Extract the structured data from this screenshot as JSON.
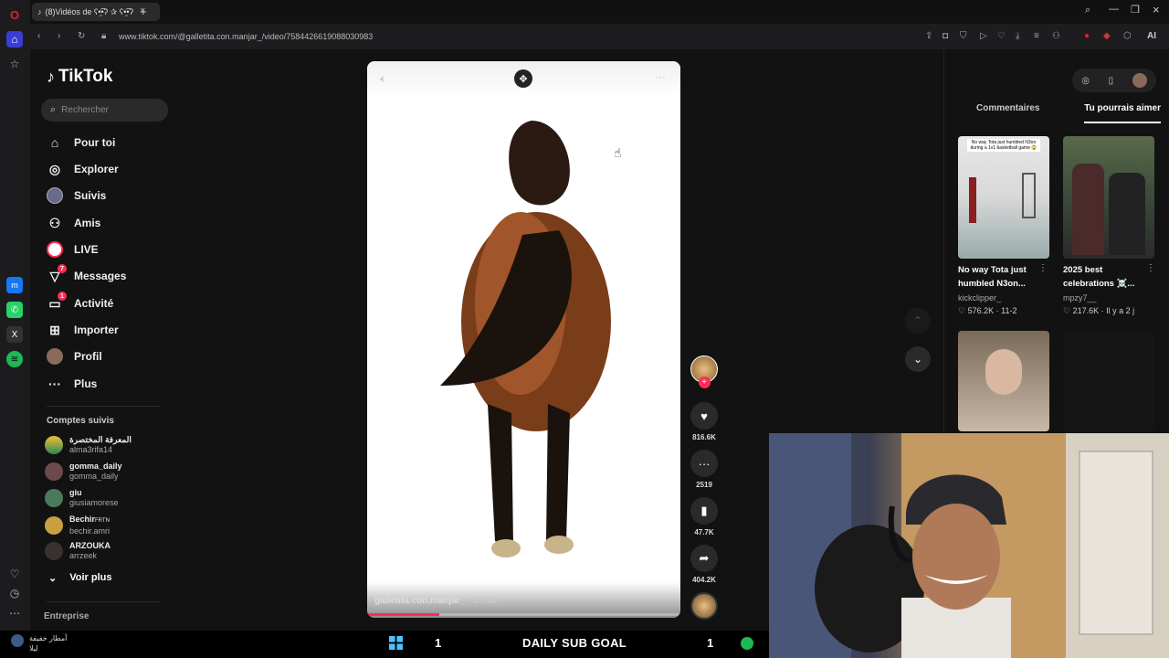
{
  "browser": {
    "tab_title": "(8)Vidéos de ʕ•̫͡•ʔ ✰ ʕ•̫͡•ʔ",
    "url": "www.tiktok.com/@galletita.con.manjar_/video/7584426619088030983",
    "ai_label": "AI"
  },
  "tiktok": {
    "logo": "TikTok",
    "search_placeholder": "Rechercher",
    "nav": [
      {
        "label": "Pour toi",
        "icon": "home-icon"
      },
      {
        "label": "Explorer",
        "icon": "compass-icon"
      },
      {
        "label": "Suivis",
        "icon": "following-avatar-icon"
      },
      {
        "label": "Amis",
        "icon": "friends-icon"
      },
      {
        "label": "LIVE",
        "icon": "live-icon"
      },
      {
        "label": "Messages",
        "icon": "messages-icon",
        "badge": "7"
      },
      {
        "label": "Activité",
        "icon": "activity-icon",
        "badge": "1"
      },
      {
        "label": "Importer",
        "icon": "upload-icon"
      },
      {
        "label": "Profil",
        "icon": "profile-icon"
      },
      {
        "label": "Plus",
        "icon": "more-icon"
      }
    ],
    "followed_title": "Comptes suivis",
    "followed": [
      {
        "name": "المعرفة المختصرة",
        "handle": "alma3rifa14"
      },
      {
        "name": "gomma_daily",
        "handle": "gomma_daily"
      },
      {
        "name": "giu",
        "handle": "giusiamorese"
      },
      {
        "name": "Bechir",
        "suffix": "FRTN",
        "handle": "bechir.amri"
      },
      {
        "name": "ARZOUKA",
        "handle": "arrzeek"
      }
    ],
    "see_more": "Voir plus",
    "company": "Entreprise"
  },
  "video": {
    "author": "galletita.con.manjar_",
    "date": "12-16",
    "progress": 0.23,
    "likes": "816.6K",
    "comments": "2519",
    "saves": "47.7K",
    "shares": "404.2K"
  },
  "right_panel": {
    "tabs": [
      "Commentaires",
      "Tu pourrais aimer"
    ],
    "active_tab": "Tu pourrais aimer",
    "cards": [
      {
        "caption": "No way Tota just humbled N3on...",
        "author": "kickclipper_",
        "likes": "576.2K",
        "date": "11-2",
        "overlay": "No way Tota just humbled N3on during a 1v1 basketball game 😱"
      },
      {
        "caption": "2025 best celebrations ☠️...",
        "author": "mpzy7__",
        "likes": "217.6K",
        "date": "Il y a 2 j"
      }
    ]
  },
  "taskbar": {
    "left_title": "أمطار خفيفة",
    "left_sub": "ليلا",
    "sub_count_left": "1",
    "sub_goal": "DAILY SUB GOAL",
    "sub_count_right": "1"
  }
}
